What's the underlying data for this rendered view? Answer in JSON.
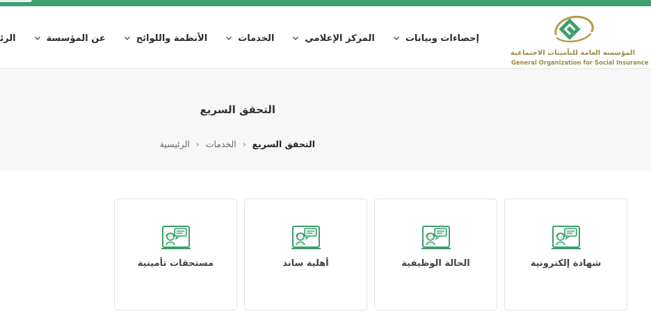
{
  "org": {
    "name_ar": "المؤسسة العامة للتأمينات الاجتماعية",
    "name_en": "General Organization for Social Insurance",
    "brand_green": "#3d9f6b",
    "brand_gold": "#b39b45"
  },
  "nav": {
    "items": [
      {
        "label": "الرئيسية",
        "has_dropdown": false
      },
      {
        "label": "عن المؤسسة",
        "has_dropdown": true
      },
      {
        "label": "الأنظمة واللوائح",
        "has_dropdown": true
      },
      {
        "label": "الخدمات",
        "has_dropdown": true
      },
      {
        "label": "المركز الإعلامي",
        "has_dropdown": true
      },
      {
        "label": "إحصاءات وبيانات",
        "has_dropdown": true
      }
    ]
  },
  "page": {
    "title": "التحقق السريع",
    "breadcrumb": [
      "الرئيسية",
      "الخدمات",
      "التحقق السريع"
    ]
  },
  "services": [
    {
      "label": "شهادة إلكترونية",
      "icon": "support-agent-icon"
    },
    {
      "label": "الحالة الوظيفية",
      "icon": "support-agent-icon"
    },
    {
      "label": "أهلية ساند",
      "icon": "support-agent-icon"
    },
    {
      "label": "مستحقات تأمينية",
      "icon": "support-agent-icon"
    }
  ]
}
